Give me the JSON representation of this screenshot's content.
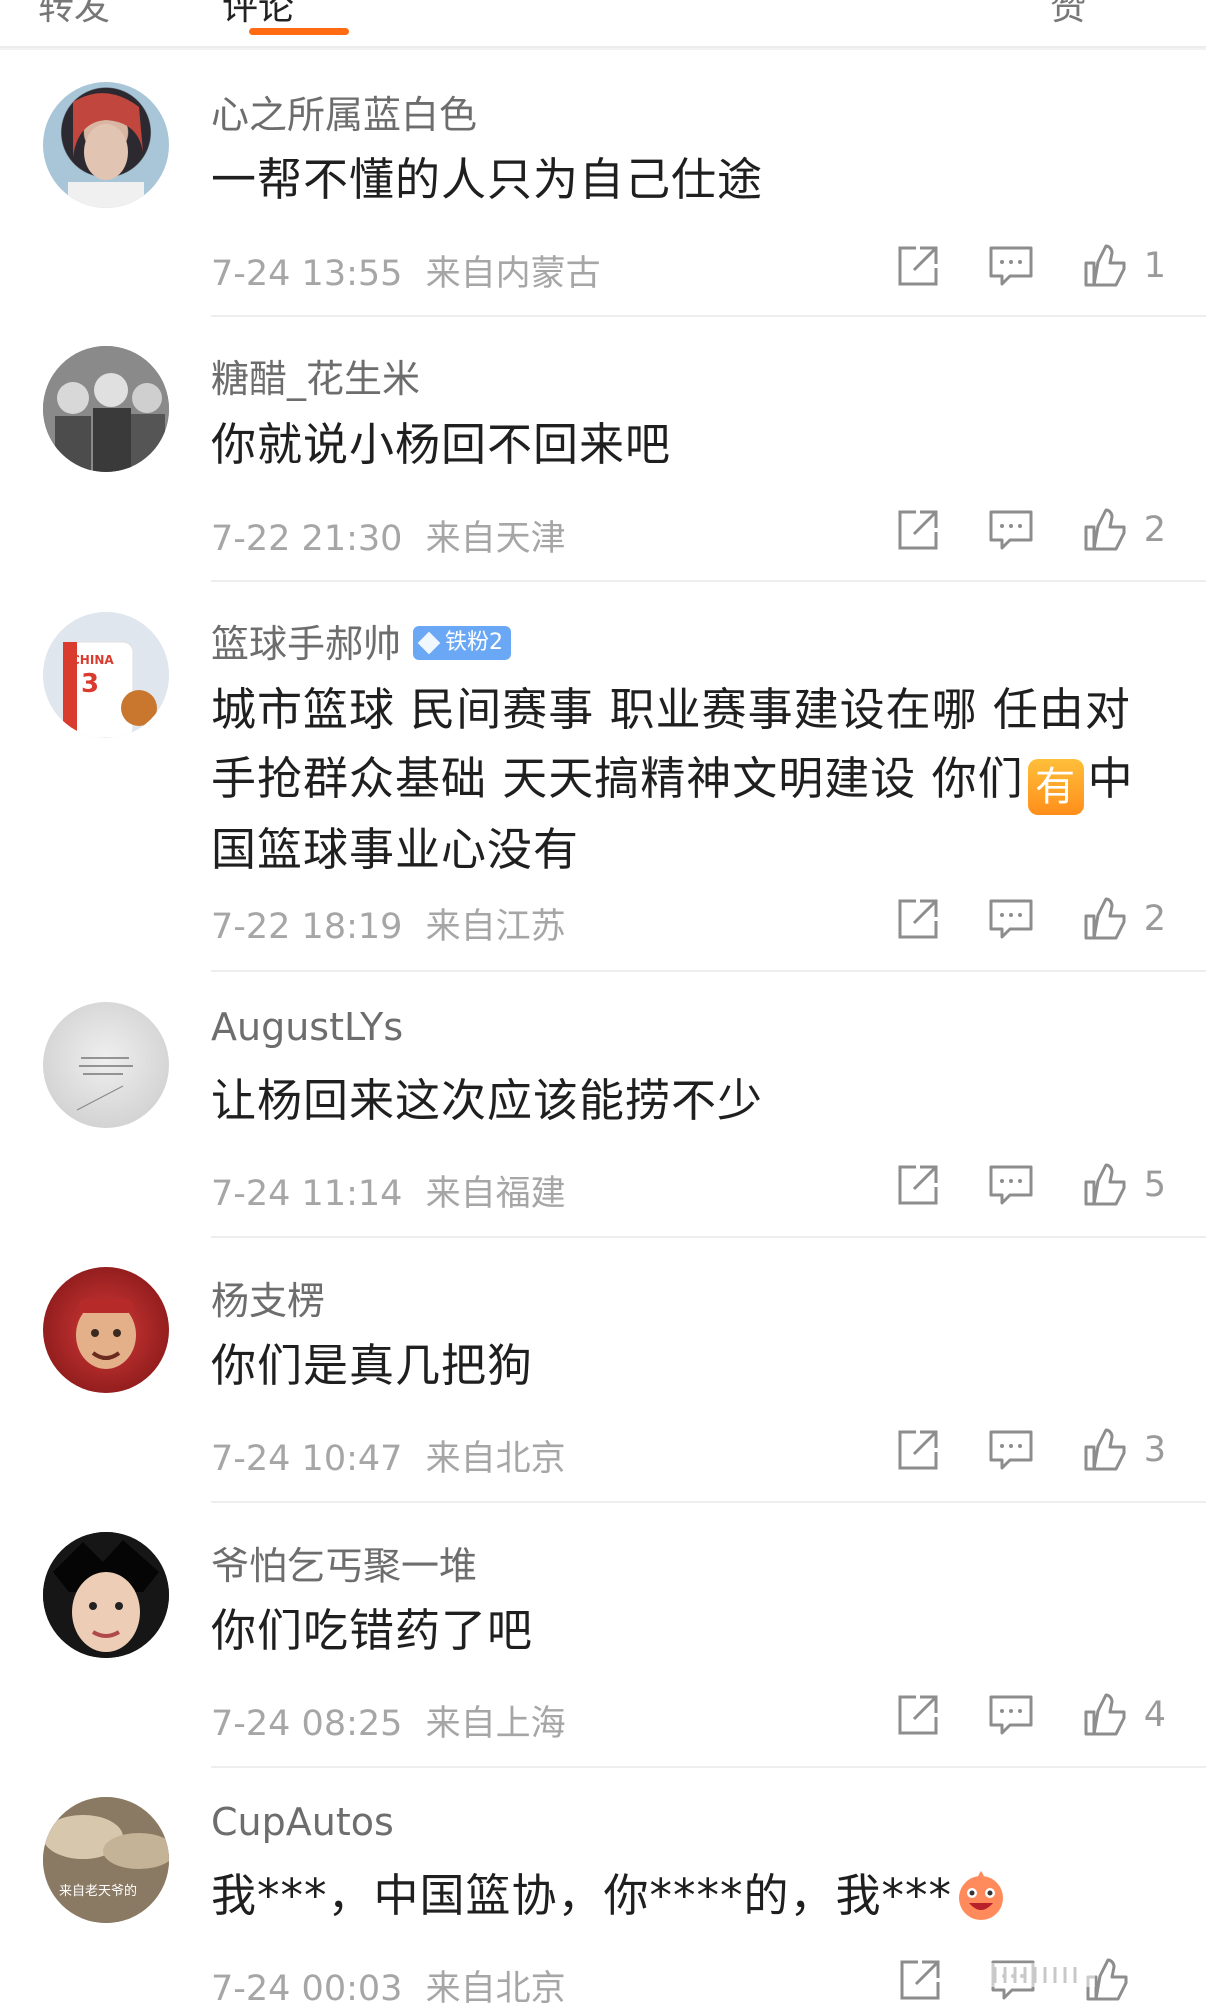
{
  "tabs": [
    {
      "label": "转发"
    },
    {
      "label": "评论"
    }
  ],
  "tabs_right_label": "赞",
  "accent_color": "#ff6a12",
  "comments": [
    {
      "user": "心之所属蓝白色",
      "text": "一帮不懂的人只为自己仕途",
      "time": "7-24 13:55",
      "location": "来自内蒙古",
      "likes": "1"
    },
    {
      "user": "糖醋_花生米",
      "text": "你就说小杨回不回来吧",
      "time": "7-22 21:30",
      "location": "来自天津",
      "likes": "2"
    },
    {
      "user": "篮球手郝帅",
      "badge": "铁粉2",
      "text_part1": "城市篮球 民间赛事 职业赛事建设在哪 任由对手抢群众基础 天天搞精神文明建设 你们",
      "emoji_text": "有",
      "text_part2": "中国篮球事业心没有",
      "time": "7-22 18:19",
      "location": "来自江苏",
      "likes": "2"
    },
    {
      "user": "AugustLYs",
      "text": "让杨回来这次应该能捞不少",
      "time": "7-24 11:14",
      "location": "来自福建",
      "likes": "5"
    },
    {
      "user": "杨支楞",
      "text": "你们是真几把狗",
      "time": "7-24 10:47",
      "location": "来自北京",
      "likes": "3"
    },
    {
      "user": "爷怕乞丐聚一堆",
      "text": "你们吃错药了吧",
      "time": "7-24 08:25",
      "location": "来自上海",
      "likes": "4"
    },
    {
      "user": "CupAutos",
      "text": "我***，中国篮协，你****的，我***",
      "time": "7-24 00:03",
      "location": "来自北京",
      "likes": ""
    }
  ],
  "avatar_texts": {
    "c3": "CHINA",
    "c7": "来自老天爷的"
  }
}
